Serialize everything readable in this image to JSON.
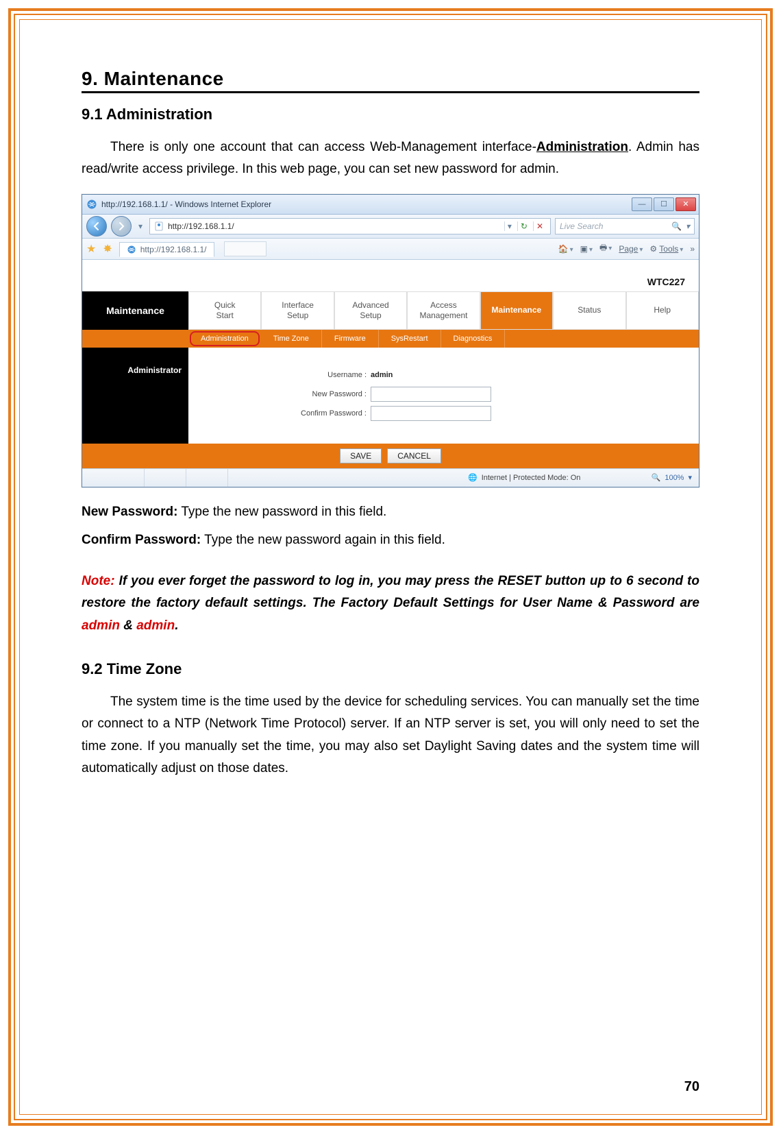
{
  "page_number": "70",
  "h1": "9. Maintenance",
  "section_9_1": {
    "title": "9.1    Administration",
    "p1_part1": "There is only one account that can access Web-Management interface-",
    "p1_link": "Administration",
    "p1_part2": ". Admin has read/write access privilege. In this web page, you can set new password for admin."
  },
  "screenshot": {
    "window_title": "http://192.168.1.1/ - Windows Internet Explorer",
    "address": "http://192.168.1.1/",
    "search_placeholder": "Live Search",
    "tab_title": "http://192.168.1.1/",
    "toolbar": {
      "page": "Page",
      "tools": "Tools"
    },
    "brand": "WTC227",
    "left_title": "Maintenance",
    "main_tabs": [
      "Quick Start",
      "Interface Setup",
      "Advanced Setup",
      "Access Management",
      "Maintenance",
      "Status",
      "Help"
    ],
    "active_main_tab": "Maintenance",
    "sub_tabs": [
      "Administration",
      "Time Zone",
      "Firmware",
      "SysRestart",
      "Diagnostics"
    ],
    "active_sub_tab": "Administration",
    "admin_label": "Administrator",
    "form": {
      "username_label": "Username :",
      "username_value": "admin",
      "new_password_label": "New Password :",
      "confirm_password_label": "Confirm Password :"
    },
    "buttons": {
      "save": "SAVE",
      "cancel": "CANCEL"
    },
    "status": {
      "text": "Internet | Protected Mode: On",
      "zoom": "100%"
    }
  },
  "post": {
    "new_pw_label": "New Password:",
    "new_pw_text": " Type the new password in this field.",
    "confirm_pw_label": "Confirm Password:",
    "confirm_pw_text": " Type the new password again in this field.",
    "note_label": "Note:",
    "note_text": " If you ever forget the password to log in, you may press the RESET button up to 6 second to restore the factory default settings. The Factory Default Settings for User Name & Password are ",
    "note_admin": "admin",
    "note_amp": " & ",
    "note_period": "."
  },
  "section_9_2": {
    "title": "9.2 Time Zone",
    "p": "The system time is the time used by the device for scheduling services. You can manually set the time or connect to a NTP (Network Time Protocol) server. If an NTP server is set, you will only need to set the time zone. If you manually set the time, you may also set Daylight Saving dates and the system time will automatically adjust on those dates."
  }
}
